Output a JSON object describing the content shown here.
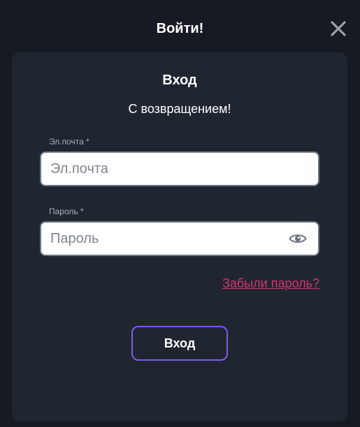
{
  "modal": {
    "title": "Войти!",
    "close_icon": "close-icon"
  },
  "card": {
    "heading": "Вход",
    "subheading": "С возвращением!"
  },
  "email": {
    "label": "Эл.почта *",
    "placeholder": "Эл.почта",
    "value": ""
  },
  "password": {
    "label": "Пароль *",
    "placeholder": "Пароль",
    "value": "",
    "toggle_icon": "eye-icon"
  },
  "forgot_link": "Забыли пароль?",
  "submit_label": "Вход",
  "colors": {
    "background": "#161b23",
    "card": "#202630",
    "accent": "#7b5cf0",
    "link": "#d6336c",
    "field_border": "#6c7785"
  }
}
